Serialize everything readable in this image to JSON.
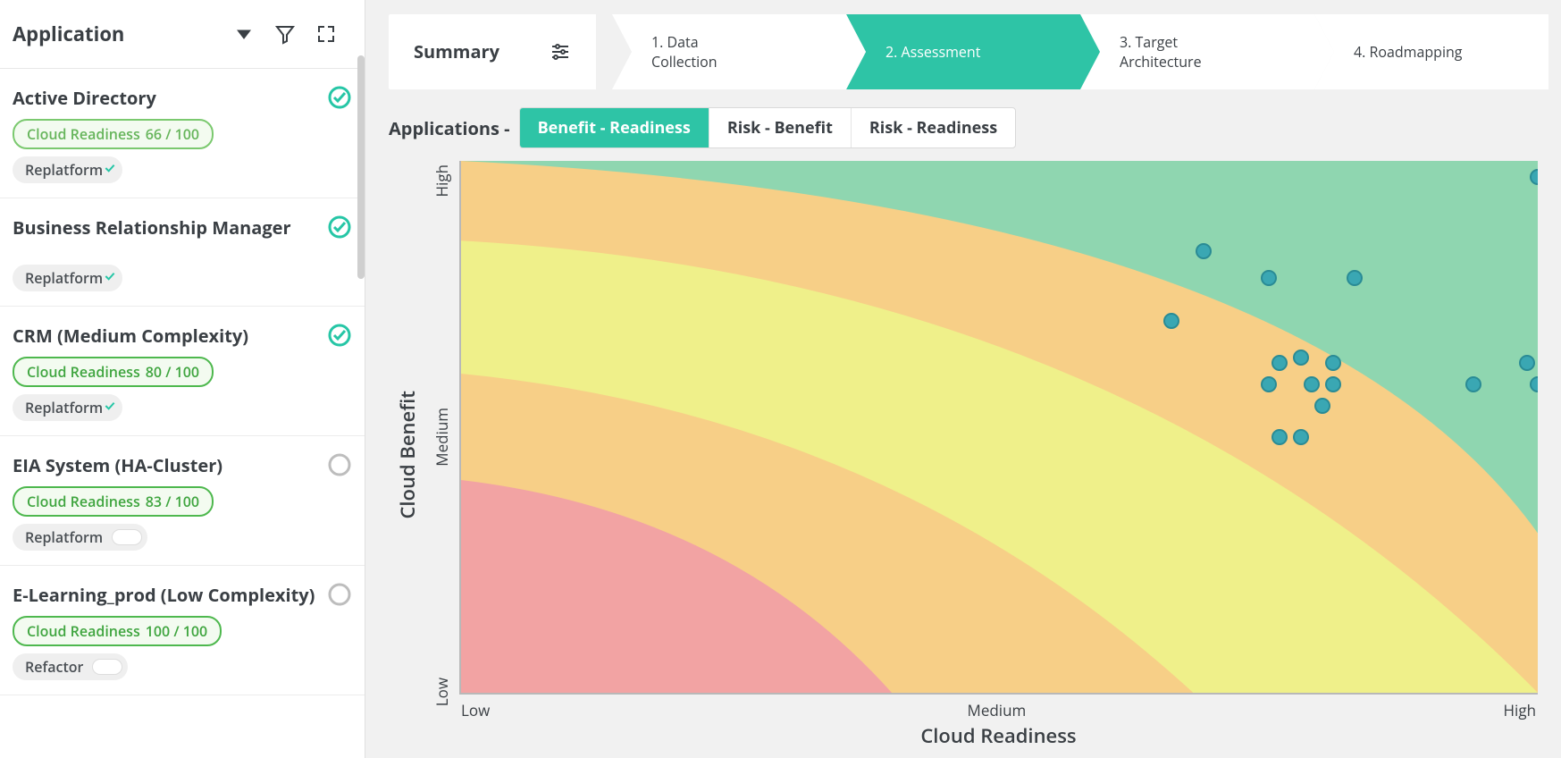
{
  "sidebar": {
    "title": "Application",
    "items": [
      {
        "name": "Active Directory",
        "readiness_label": "Cloud Readiness",
        "readiness_score": "66 / 100",
        "readiness_strong": false,
        "strategy": "Replatform",
        "strategy_checked": true,
        "status": "done"
      },
      {
        "name": "Business Relationship Manager",
        "readiness_label": "",
        "readiness_score": "",
        "readiness_strong": false,
        "strategy": "Replatform",
        "strategy_checked": true,
        "status": "done"
      },
      {
        "name": "CRM (Medium Complexity)",
        "readiness_label": "Cloud Readiness",
        "readiness_score": "80 / 100",
        "readiness_strong": true,
        "strategy": "Replatform",
        "strategy_checked": true,
        "status": "done"
      },
      {
        "name": "EIA System (HA-Cluster)",
        "readiness_label": "Cloud Readiness",
        "readiness_score": "83 / 100",
        "readiness_strong": true,
        "strategy": "Replatform",
        "strategy_checked": false,
        "status": "pending"
      },
      {
        "name": "E-Learning_prod (Low Complexity)",
        "readiness_label": "Cloud Readiness",
        "readiness_score": "100 / 100",
        "readiness_strong": true,
        "strategy": "Refactor",
        "strategy_checked": false,
        "status": "pending"
      }
    ]
  },
  "stepper": {
    "summary": "Summary",
    "steps": [
      {
        "label": "1. Data Collection"
      },
      {
        "label": "2. Assessment"
      },
      {
        "label": "3. Target Architecture"
      },
      {
        "label": "4. Roadmapping"
      }
    ],
    "active_index": 1
  },
  "subnav": {
    "prefix": "Applications -",
    "tabs": [
      "Benefit - Readiness",
      "Risk - Benefit",
      "Risk - Readiness"
    ],
    "active_index": 0
  },
  "chart_data": {
    "type": "scatter",
    "title": "",
    "xlabel": "Cloud Readiness",
    "ylabel": "Cloud Benefit",
    "x_ticks": [
      "Low",
      "Medium",
      "High"
    ],
    "y_ticks": [
      "Low",
      "Medium",
      "High"
    ],
    "xlim": [
      0,
      100
    ],
    "ylim": [
      0,
      100
    ],
    "zones": [
      {
        "name": "low",
        "color": "#f2a3a3"
      },
      {
        "name": "med-low",
        "color": "#f7cf87"
      },
      {
        "name": "med",
        "color": "#eff08a"
      },
      {
        "name": "high",
        "color": "#8fd6b0"
      }
    ],
    "series": [
      {
        "name": "Applications",
        "color": "#3aa7b3",
        "points": [
          {
            "x": 66,
            "y": 70
          },
          {
            "x": 69,
            "y": 83
          },
          {
            "x": 75,
            "y": 78
          },
          {
            "x": 75,
            "y": 58
          },
          {
            "x": 76,
            "y": 48
          },
          {
            "x": 76,
            "y": 62
          },
          {
            "x": 78,
            "y": 63
          },
          {
            "x": 78,
            "y": 48
          },
          {
            "x": 79,
            "y": 58
          },
          {
            "x": 80,
            "y": 54
          },
          {
            "x": 81,
            "y": 58
          },
          {
            "x": 81,
            "y": 62
          },
          {
            "x": 83,
            "y": 78
          },
          {
            "x": 94,
            "y": 58
          },
          {
            "x": 99,
            "y": 62
          },
          {
            "x": 100,
            "y": 97
          },
          {
            "x": 100,
            "y": 58
          }
        ]
      }
    ]
  }
}
